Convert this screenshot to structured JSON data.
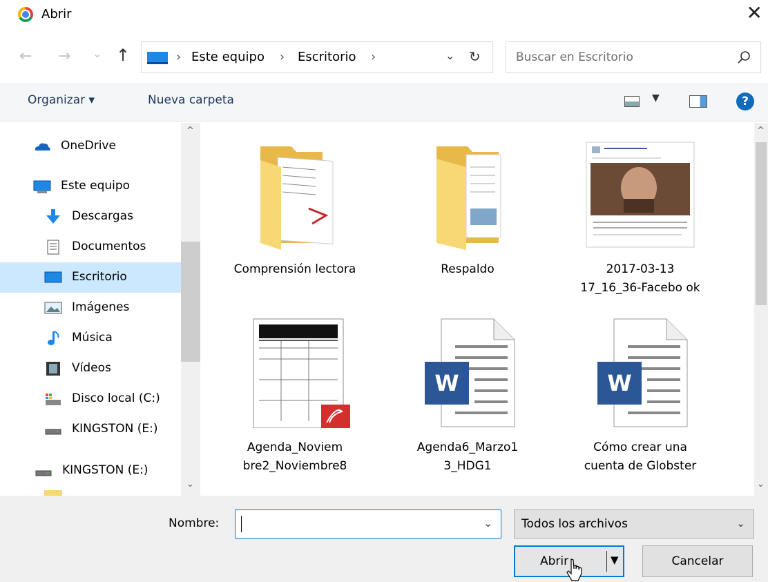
{
  "window": {
    "title": "Abrir",
    "close_glyph": "✕"
  },
  "nav": {
    "back": "←",
    "forward": "→",
    "recent": "⌄",
    "up": "↑",
    "path": [
      "Este equipo",
      "Escritorio"
    ],
    "separator": "›",
    "dropdown": "⌄",
    "refresh": "↻"
  },
  "search": {
    "placeholder": "Buscar en Escritorio"
  },
  "toolbar": {
    "organize": "Organizar ▾",
    "new_folder": "Nueva carpeta",
    "view_drop": "▼",
    "help": "?"
  },
  "sidebar": {
    "items": [
      {
        "label": "OneDrive",
        "icon": "onedrive-icon"
      },
      {
        "label": "Este equipo",
        "icon": "computer-icon"
      },
      {
        "label": "Descargas",
        "icon": "download-icon"
      },
      {
        "label": "Documentos",
        "icon": "documents-icon"
      },
      {
        "label": "Escritorio",
        "icon": "desktop-icon",
        "selected": true
      },
      {
        "label": "Imágenes",
        "icon": "pictures-icon"
      },
      {
        "label": "Música",
        "icon": "music-icon"
      },
      {
        "label": "Vídeos",
        "icon": "videos-icon"
      },
      {
        "label": "Disco local (C:)",
        "icon": "local-disk-icon"
      },
      {
        "label": "KINGSTON (E:)",
        "icon": "usb-drive-icon"
      },
      {
        "label": "KINGSTON (E:)",
        "icon": "usb-drive-icon"
      }
    ],
    "scroll_up": "^",
    "scroll_down": "⌄"
  },
  "files": [
    {
      "name": "Comprensión lectora",
      "type": "folder-docs"
    },
    {
      "name": "Respaldo",
      "type": "folder"
    },
    {
      "name": "2017-03-13 17_16_36-Facebo ok",
      "type": "image"
    },
    {
      "name": "Agenda_Noviem bre2_Noviembre8",
      "type": "pdf"
    },
    {
      "name": "Agenda6_Marzo1 3_HDG1",
      "type": "word"
    },
    {
      "name": "Cómo crear una cuenta de Globster",
      "type": "word"
    }
  ],
  "word_badge": "W",
  "footer": {
    "name_label": "Nombre:",
    "name_value": "",
    "filetype": "Todos los archivos",
    "open": "Abrir",
    "cancel": "Cancelar",
    "dropdown": "⌄",
    "split_arrow": "▼"
  },
  "colors": {
    "accent": "#0078d7",
    "selected": "#cce8ff",
    "folder": "#f8d775",
    "word": "#2b5797",
    "pdf": "#d32f2f"
  }
}
